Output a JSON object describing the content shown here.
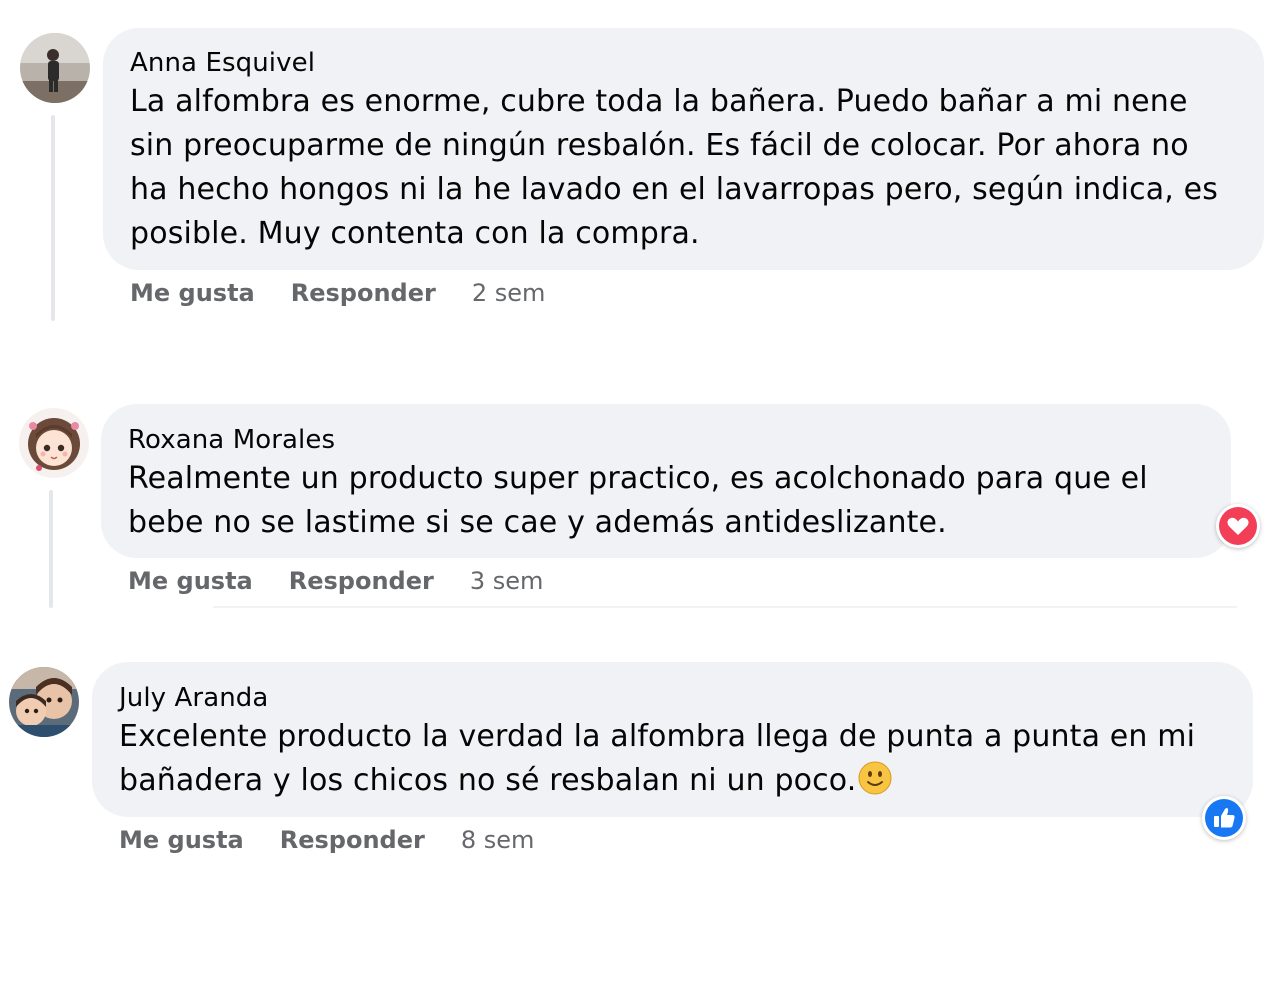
{
  "comments": [
    {
      "author": "Anna Esquivel",
      "text": "La alfombra es enorme, cubre toda la bañera. Puedo bañar a mi nene sin preocuparme de ningún resbalón. Es fácil de colocar. Por ahora no ha hecho hongos ni la he lavado en el lavarropas pero, según indica, es posible. Muy contenta con la compra.",
      "like_label": "Me gusta",
      "reply_label": "Responder",
      "time": "2 sem"
    },
    {
      "author": "Roxana Morales",
      "text": "Realmente un producto super practico, es acolchonado para que el bebe no se lastime si se cae y además antideslizante.",
      "like_label": "Me gusta",
      "reply_label": "Responder",
      "time": "3 sem",
      "reaction": "heart-icon"
    },
    {
      "author": "July Aranda",
      "text": "Excelente producto la verdad la alfombra llega de punta a punta en mi bañadera y los chicos no sé resbalan ni un poco.",
      "emoji": "slightly-smiling-face-icon",
      "like_label": "Me gusta",
      "reply_label": "Responder",
      "time": "8 sem",
      "reaction": "thumbs-up-icon"
    }
  ],
  "colors": {
    "bubble": "#f0f2f5",
    "action_text": "#65676b",
    "love_reaction": "#f33e58",
    "like_reaction": "#1877f2"
  }
}
